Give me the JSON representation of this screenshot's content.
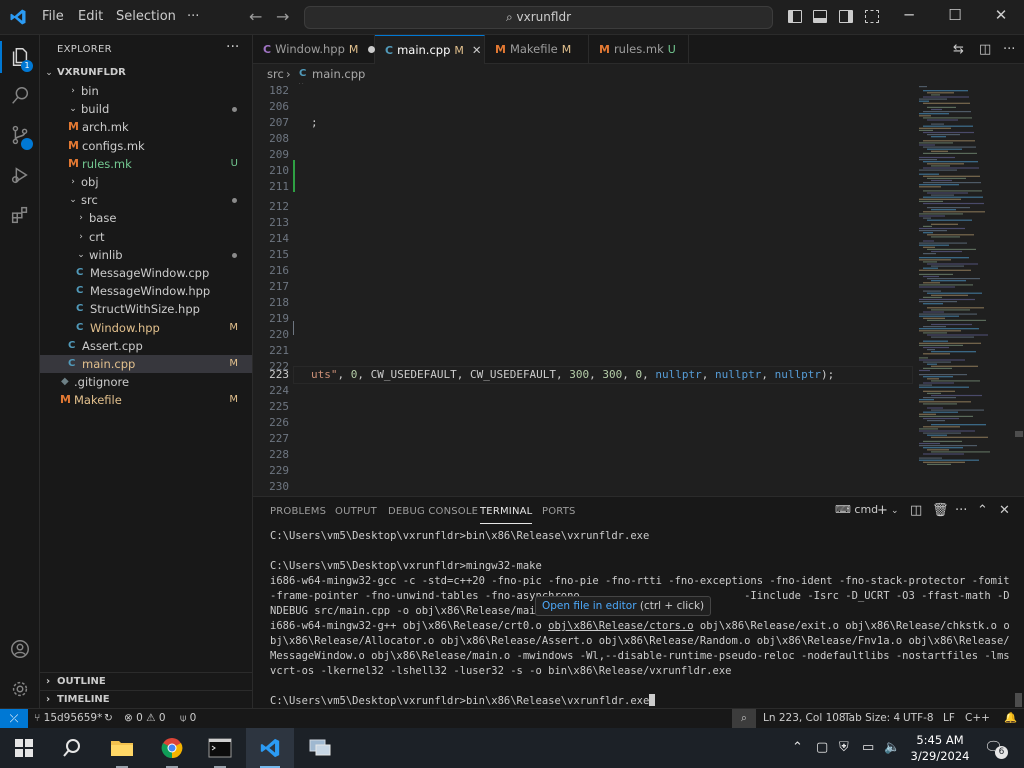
{
  "titlebar": {
    "menu": [
      "File",
      "Edit",
      "Selection",
      "···"
    ],
    "search": "vxrunfldr",
    "window_controls": {
      "minimize": "─",
      "maximize": "☐",
      "close": "✕"
    }
  },
  "activity": {
    "explorer_badge": "1"
  },
  "sidebar": {
    "header": "EXPLORER",
    "more": "···",
    "root": "VXRUNFLDR",
    "tree": [
      {
        "label": "bin",
        "kind": "folder",
        "open": false,
        "depth": 1,
        "status": ""
      },
      {
        "label": "build",
        "kind": "folder",
        "open": true,
        "depth": 1,
        "status": "dot"
      },
      {
        "label": "arch.mk",
        "kind": "make",
        "depth": 2,
        "status": ""
      },
      {
        "label": "configs.mk",
        "kind": "make",
        "depth": 2,
        "status": ""
      },
      {
        "label": "rules.mk",
        "kind": "make",
        "depth": 2,
        "status": "U"
      },
      {
        "label": "obj",
        "kind": "folder",
        "open": false,
        "depth": 1,
        "status": ""
      },
      {
        "label": "src",
        "kind": "folder",
        "open": true,
        "depth": 1,
        "status": "dot"
      },
      {
        "label": "base",
        "kind": "folder",
        "open": false,
        "depth": 2,
        "status": ""
      },
      {
        "label": "crt",
        "kind": "folder",
        "open": false,
        "depth": 2,
        "status": ""
      },
      {
        "label": "winlib",
        "kind": "folder",
        "open": true,
        "depth": 2,
        "status": "dot"
      },
      {
        "label": "MessageWindow.cpp",
        "kind": "cpp",
        "depth": 3,
        "status": ""
      },
      {
        "label": "MessageWindow.hpp",
        "kind": "cpp",
        "depth": 3,
        "status": ""
      },
      {
        "label": "StructWithSize.hpp",
        "kind": "cpp",
        "depth": 3,
        "status": ""
      },
      {
        "label": "Window.hpp",
        "kind": "cpp",
        "depth": 3,
        "status": "M"
      },
      {
        "label": "Assert.cpp",
        "kind": "cpp",
        "depth": 2,
        "status": ""
      },
      {
        "label": "main.cpp",
        "kind": "cpp",
        "depth": 2,
        "status": "M",
        "selected": true
      },
      {
        "label": ".gitignore",
        "kind": "git",
        "depth": 1,
        "status": ""
      },
      {
        "label": "Makefile",
        "kind": "make",
        "depth": 1,
        "status": "M"
      }
    ],
    "outline": "OUTLINE",
    "timeline": "TIMELINE"
  },
  "tabs": [
    {
      "label": "Window.hpp",
      "status": "M",
      "icon": "C",
      "state": "dirty"
    },
    {
      "label": "main.cpp",
      "status": "M",
      "icon": "C",
      "state": "active"
    },
    {
      "label": "Makefile",
      "status": "M",
      "icon": "M",
      "state": ""
    },
    {
      "label": "rules.mk",
      "status": "U",
      "icon": "M",
      "state": ""
    }
  ],
  "breadcrumb": {
    "folder": "src",
    "sep": "›",
    "file": "main.cpp"
  },
  "editor": {
    "lines": [
      {
        "n": "182",
        "code": ""
      },
      {
        "n": "206",
        "code": ""
      },
      {
        "n": "207",
        "code": ";"
      },
      {
        "n": "208",
        "code": ""
      },
      {
        "n": "209",
        "code": ""
      },
      {
        "n": "210",
        "code": ""
      },
      {
        "n": "211",
        "code": ""
      },
      {
        "n": "212",
        "code": ""
      },
      {
        "n": "213",
        "code": ""
      },
      {
        "n": "214",
        "code": ""
      },
      {
        "n": "215",
        "code": ""
      },
      {
        "n": "216",
        "code": ""
      },
      {
        "n": "217",
        "code": ""
      },
      {
        "n": "218",
        "code": ""
      },
      {
        "n": "219",
        "code": ""
      },
      {
        "n": "220",
        "code": ""
      },
      {
        "n": "221",
        "code": ""
      },
      {
        "n": "222",
        "code": ""
      },
      {
        "n": "223",
        "code": "current"
      },
      {
        "n": "224",
        "code": ""
      },
      {
        "n": "225",
        "code": ""
      },
      {
        "n": "226",
        "code": ""
      },
      {
        "n": "227",
        "code": ""
      },
      {
        "n": "228",
        "code": ""
      },
      {
        "n": "229",
        "code": ""
      },
      {
        "n": "230",
        "code": ""
      }
    ],
    "line223": {
      "str": "uts\"",
      "p1": ", ",
      "n1": "0",
      "p2": ", CW_USEDEFAULT, CW_USEDEFAULT, ",
      "n2": "300",
      "p3": ", ",
      "n3": "300",
      "p4": ", ",
      "n4": "0",
      "p5": ", ",
      "k1": "nullptr",
      "p6": ", ",
      "k2": "nullptr",
      "p7": ", ",
      "k3": "nullptr",
      "p8": ");"
    }
  },
  "panel": {
    "tabs": [
      "PROBLEMS",
      "OUTPUT",
      "DEBUG CONSOLE",
      "TERMINAL",
      "PORTS"
    ],
    "active_tab": "TERMINAL",
    "shell": "cmd",
    "terminal": {
      "l1": "C:\\Users\\vm5\\Desktop\\vxrunfldr>bin\\x86\\Release\\vxrunfldr.exe",
      "l2": "C:\\Users\\vm5\\Desktop\\vxrunfldr>mingw32-make",
      "l3": "i686-w64-mingw32-gcc -c -std=c++20 -fno-pic -fno-pie -fno-rtti -fno-exceptions -fno-ident -fno-stack-protector -fomit-frame-pointer -fno-unwind-tables -fno-asynchrono                          -Iinclude -Isrc -D_UCRT -O3 -ffast-math -DNDEBUG src/main.cpp -o obj\\x86\\Release/main.o",
      "l4a": "i686-w64-mingw32-g++ obj\\x86\\Release/crt0.o ",
      "l4link": "obj\\x86\\Release/ctors.o",
      "l4b": " obj\\x86\\Release/exit.o obj\\x86\\Release/chkstk.o obj\\x86\\Release/Allocator.o obj\\x86\\Release/Assert.o obj\\x86\\Release/Random.o obj\\x86\\Release/Fnv1a.o obj\\x86\\Release/MessageWindow.o obj\\x86\\Release/main.o -mwindows -Wl,--disable-runtime-pseudo-reloc -nodefaultlibs -nostartfiles -lmsvcrt-os -lkernel32 -lshell32 -luser32 -s -o bin\\x86\\Release/vxrunfldr.exe",
      "l5": "C:\\Users\\vm5\\Desktop\\vxrunfldr>bin\\x86\\Release\\vxrunfldr.exe"
    },
    "tooltip": {
      "link": "Open file in editor",
      "hint": " (ctrl + click)"
    }
  },
  "statusbar": {
    "remote": "⤫",
    "branch": "15d95659*",
    "sync": "↻",
    "errors": "⊗ 0 ⚠ 0",
    "ports": "⍦ 0",
    "position": "Ln 223, Col 108",
    "tabsize": "Tab Size: 4",
    "encoding": "UTF-8",
    "eol": "LF",
    "language": "C++"
  },
  "taskbar": {
    "time": "5:45 AM",
    "date": "3/29/2024",
    "notifications": "6"
  },
  "colors": {
    "accent": "#0078d4",
    "modified": "#e2c08d",
    "untracked": "#73c991",
    "string": "#ce9178",
    "number": "#b5cea8",
    "keyword": "#569cd6"
  }
}
